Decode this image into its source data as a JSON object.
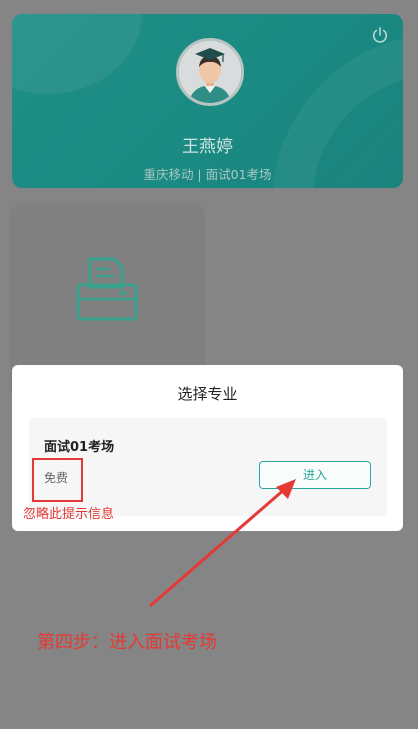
{
  "profile": {
    "name": "王燕婷",
    "subtitle": "重庆移动 | 面试01考场"
  },
  "modal": {
    "title": "选择专业",
    "option": {
      "name": "面试01考场",
      "price": "免费",
      "enter_label": "进入"
    }
  },
  "annotations": {
    "ignore_hint": "忽略此提示信息",
    "step": "第四步：进入面试考场"
  },
  "colors": {
    "brand": "#1f8f86",
    "accent": "#2aa79b",
    "annotation": "#e53935",
    "overlay": "#858585"
  },
  "icons": {
    "power": "power-icon",
    "printer": "printer-icon"
  }
}
